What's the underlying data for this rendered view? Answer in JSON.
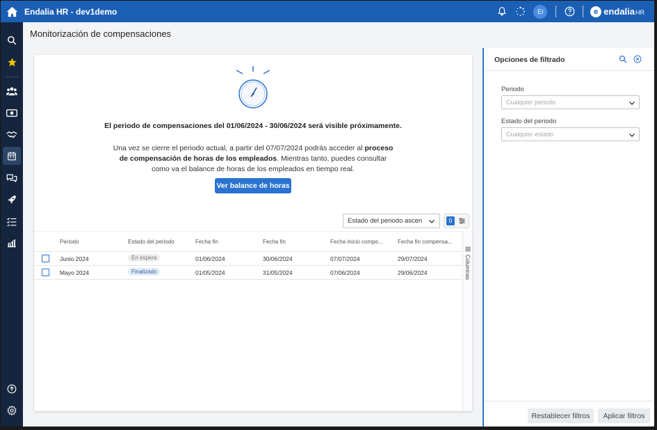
{
  "app": {
    "title": "Endalia HR - dev1demo",
    "avatar_initials": "EI",
    "brand": "endalia",
    "brand_suffix": "HR",
    "brand_mark": "e"
  },
  "colors": {
    "primary": "#1b5fb5",
    "accent": "#2a73d0",
    "sidebar": "#14253d"
  },
  "sidebar": {
    "items": [
      {
        "icon": "search-icon"
      },
      {
        "icon": "star-icon"
      },
      {
        "icon": "people-icon"
      },
      {
        "icon": "money-icon"
      },
      {
        "icon": "handshake-icon"
      },
      {
        "icon": "calendar-icon",
        "active": true
      },
      {
        "icon": "chat-icon"
      },
      {
        "icon": "rocket-icon"
      },
      {
        "icon": "checklist-icon"
      },
      {
        "icon": "chart-icon"
      }
    ],
    "bottom": [
      {
        "icon": "upload-icon"
      },
      {
        "icon": "settings-icon"
      }
    ]
  },
  "page": {
    "title": "Monitorización de compensaciones"
  },
  "notice": {
    "title": "El periodo de compensaciones del 01/06/2024 - 30/06/2024 será visible próximamente.",
    "body_1": "Una vez se cierre el periodo actual, a partir del 07/07/2024 podrás acceder al",
    "body_bold": "proceso de compensación de horas de los empleados",
    "body_2": ". Mientras tanto, puedes consultar como va el balance de horas de los empleados en tiempo real.",
    "button": "Ver balance de horas"
  },
  "toolbar": {
    "sort_value": "Estado del periodo ascen",
    "filter_count": "0"
  },
  "table": {
    "headers": [
      "Periodo",
      "Estado del periodo",
      "Fecha fin",
      "Fecha fin",
      "Fecha inicio compe...",
      "Fecha fin compensa..."
    ],
    "rows": [
      {
        "periodo": "Junio 2024",
        "estado": "En espera",
        "estado_kind": "wait",
        "c3": "01/06/2024",
        "c4": "30/06/2024",
        "c5": "07/07/2024",
        "c6": "29/07/2024"
      },
      {
        "periodo": "Mayo 2024",
        "estado": "Finalizado",
        "estado_kind": "done",
        "c3": "01/05/2024",
        "c4": "31/05/2024",
        "c5": "07/06/2024",
        "c6": "29/06/2024"
      }
    ],
    "columns_label": "Columnas"
  },
  "filters": {
    "title": "Opciones de filtrado",
    "periodo_label": "Periodo",
    "periodo_placeholder": "Cualquier periodo",
    "estado_label": "Estado del periodo",
    "estado_placeholder": "Cualquier estado",
    "reset_button": "Restablecer filtros",
    "apply_button": "Aplicar filtros"
  }
}
